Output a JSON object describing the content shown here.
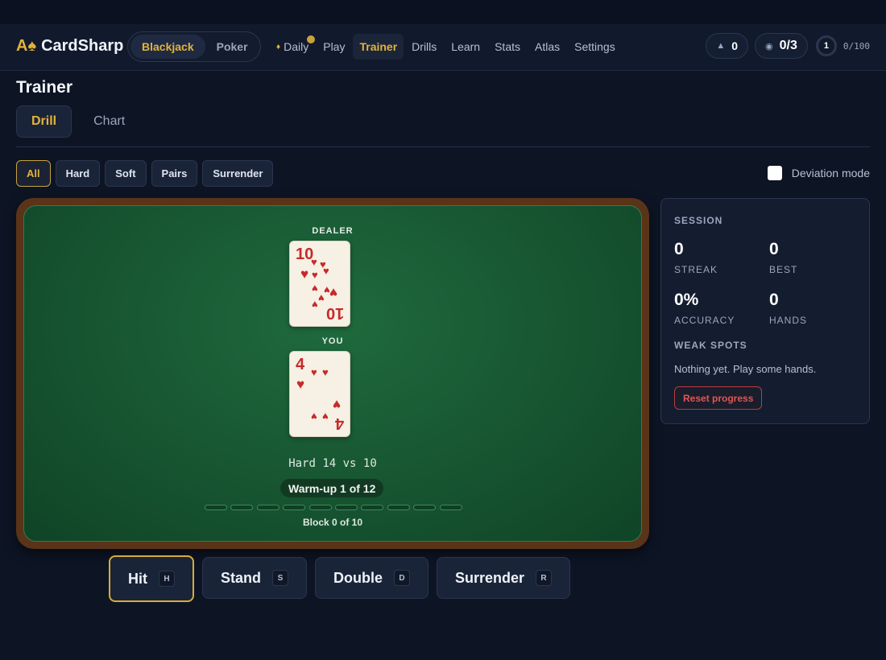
{
  "app": {
    "logo_mark": "A♠",
    "name": "CardSharp"
  },
  "game_switch": [
    {
      "label": "Blackjack",
      "active": true
    },
    {
      "label": "Poker",
      "active": false
    }
  ],
  "nav": [
    {
      "label": "Daily",
      "active": false,
      "badge": true
    },
    {
      "label": "Play",
      "active": false
    },
    {
      "label": "Trainer",
      "active": true
    },
    {
      "label": "Drills",
      "active": false
    },
    {
      "label": "Learn",
      "active": false
    },
    {
      "label": "Stats",
      "active": false
    },
    {
      "label": "Atlas",
      "active": false
    },
    {
      "label": "Settings",
      "active": false
    }
  ],
  "header_stats": {
    "streak": "0",
    "goals": "0/3",
    "level": "1",
    "xp": "0/100"
  },
  "page": {
    "title": "Trainer"
  },
  "tabs": [
    {
      "label": "Drill",
      "active": true
    },
    {
      "label": "Chart",
      "active": false
    }
  ],
  "filters": [
    {
      "label": "All",
      "active": true
    },
    {
      "label": "Hard",
      "active": false
    },
    {
      "label": "Soft",
      "active": false
    },
    {
      "label": "Pairs",
      "active": false
    },
    {
      "label": "Surrender",
      "active": false
    }
  ],
  "deviation": {
    "label": "Deviation mode",
    "checked": false
  },
  "table": {
    "dealer_label": "DEALER",
    "you_label": "YOU",
    "dealer_card": {
      "rank": "10",
      "suit": "hearts"
    },
    "player_card": {
      "rank": "4",
      "suit": "hearts"
    },
    "hand_desc": "Hard 14 vs 10",
    "warmup": "Warm-up 1 of 12",
    "block_progress": 0,
    "block_total": 10,
    "block_label": "Block 0 of 10"
  },
  "session": {
    "title": "SESSION",
    "streak_value": "0",
    "streak_label": "STREAK",
    "best_value": "0",
    "best_label": "BEST",
    "accuracy_value": "0%",
    "accuracy_label": "ACCURACY",
    "hands_value": "0",
    "hands_label": "HANDS",
    "weak_title": "WEAK SPOTS",
    "weak_text": "Nothing yet. Play some hands.",
    "reset_label": "Reset progress"
  },
  "actions": [
    {
      "label": "Hit",
      "key": "H",
      "primary": true
    },
    {
      "label": "Stand",
      "key": "S",
      "primary": false
    },
    {
      "label": "Double",
      "key": "D",
      "primary": false
    },
    {
      "label": "Surrender",
      "key": "R",
      "primary": false
    }
  ],
  "colors": {
    "accent": "#e2b33b",
    "felt": "#175531",
    "rail": "#5a3418",
    "danger": "#e05656"
  }
}
